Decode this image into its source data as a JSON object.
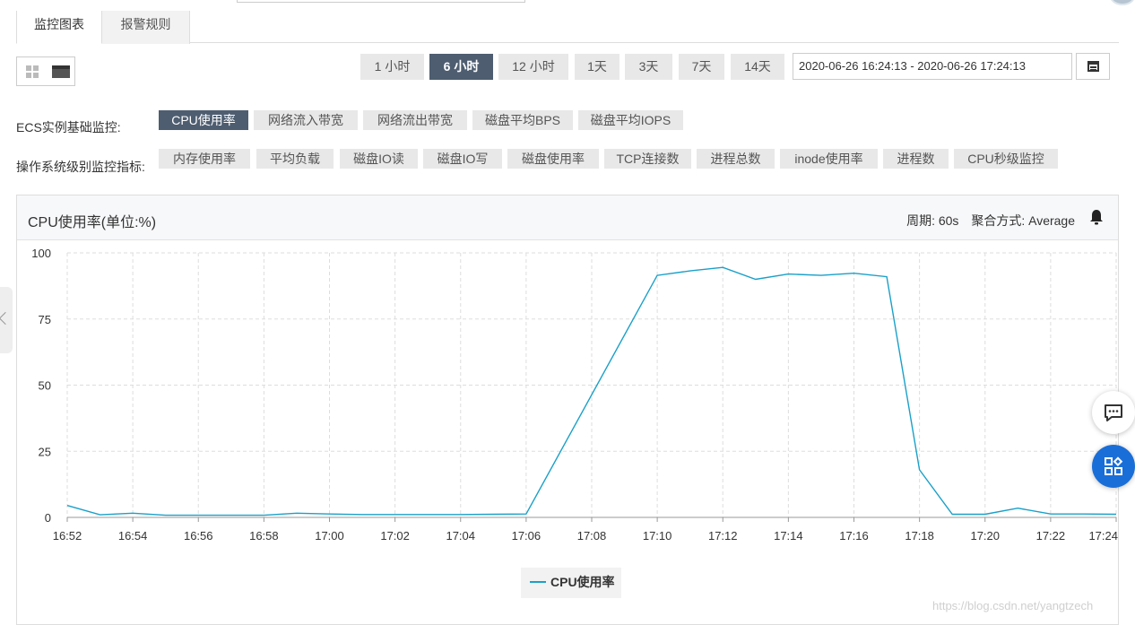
{
  "tabs": [
    {
      "label": "监控图表",
      "active": true
    },
    {
      "label": "报警规则",
      "active": false
    }
  ],
  "time_ranges": [
    {
      "label": "1 小时",
      "selected": false
    },
    {
      "label": "6 小时",
      "selected": true
    },
    {
      "label": "12 小时",
      "selected": false
    },
    {
      "label": "1天",
      "selected": false
    },
    {
      "label": "3天",
      "selected": false
    },
    {
      "label": "7天",
      "selected": false
    },
    {
      "label": "14天",
      "selected": false
    }
  ],
  "date_range": "2020-06-26 16:24:13 - 2020-06-26 17:24:13",
  "metric_rows": [
    {
      "label": "ECS实例基础监控:",
      "items": [
        {
          "label": "CPU使用率",
          "selected": true
        },
        {
          "label": "网络流入带宽",
          "selected": false
        },
        {
          "label": "网络流出带宽",
          "selected": false
        },
        {
          "label": "磁盘平均BPS",
          "selected": false
        },
        {
          "label": "磁盘平均IOPS",
          "selected": false
        }
      ]
    },
    {
      "label": "操作系统级别监控指标:",
      "items": [
        {
          "label": "内存使用率",
          "selected": false
        },
        {
          "label": "平均负载",
          "selected": false
        },
        {
          "label": "磁盘IO读",
          "selected": false
        },
        {
          "label": "磁盘IO写",
          "selected": false
        },
        {
          "label": "磁盘使用率",
          "selected": false
        },
        {
          "label": "TCP连接数",
          "selected": false
        },
        {
          "label": "进程总数",
          "selected": false
        },
        {
          "label": "inode使用率",
          "selected": false
        },
        {
          "label": "进程数",
          "selected": false
        },
        {
          "label": "CPU秒级监控",
          "selected": false
        }
      ]
    }
  ],
  "panel": {
    "title": "CPU使用率(单位:%)",
    "period": "周期: 60s",
    "aggregation": "聚合方式: Average",
    "bell_icon": "bell-icon"
  },
  "chart_data": {
    "type": "line",
    "title": "CPU使用率(单位:%)",
    "xlabel": "",
    "ylabel": "",
    "ylim": [
      0,
      100
    ],
    "yticks": [
      "0",
      "25",
      "50",
      "75",
      "100"
    ],
    "xticks": [
      "16:52",
      "16:54",
      "16:56",
      "16:58",
      "17:00",
      "17:02",
      "17:04",
      "17:06",
      "17:08",
      "17:10",
      "17:12",
      "17:14",
      "17:16",
      "17:18",
      "17:20",
      "17:22",
      "17:24"
    ],
    "grid": true,
    "legend": "bottom-center",
    "color": "#1aa0c8",
    "series": [
      {
        "name": "CPU使用率",
        "x": [
          "16:52",
          "16:53",
          "16:54",
          "16:55",
          "16:56",
          "16:57",
          "16:58",
          "16:59",
          "17:00",
          "17:01",
          "17:02",
          "17:03",
          "17:04",
          "17:05",
          "17:06",
          "17:10",
          "17:11",
          "17:12",
          "17:13",
          "17:14",
          "17:15",
          "17:16",
          "17:17",
          "17:18",
          "17:19",
          "17:20",
          "17:21",
          "17:22",
          "17:23",
          "17:24"
        ],
        "values": [
          4.5,
          1,
          1.6,
          0.8,
          0.8,
          0.8,
          0.8,
          1.6,
          1.3,
          1.1,
          1.1,
          1.1,
          1.1,
          1.2,
          1.3,
          91.5,
          93.2,
          94.5,
          90,
          92,
          91.5,
          92.3,
          91,
          18,
          1.2,
          1.2,
          3.5,
          1.3,
          1.3,
          1.2
        ]
      }
    ]
  },
  "icons": {
    "chat": "chat-icon",
    "apps": "apps-icon",
    "calendar": "calendar-icon"
  },
  "watermark": "https://blog.csdn.net/yangtzech"
}
